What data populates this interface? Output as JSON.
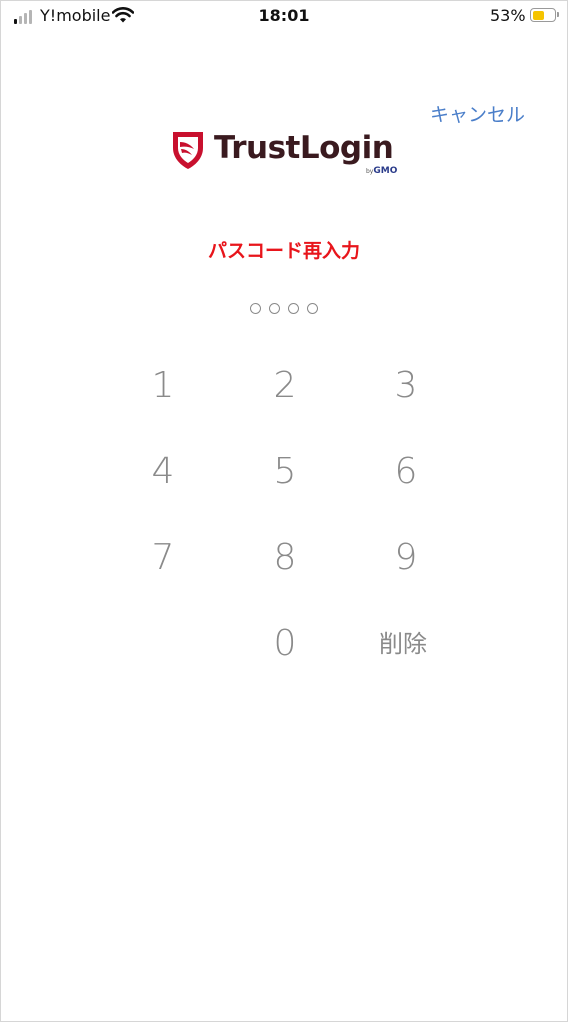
{
  "status_bar": {
    "carrier": "Y!mobile",
    "time": "18:01",
    "battery_percent": "53%",
    "battery_level": 0.53,
    "battery_color": "#f5c400"
  },
  "header": {
    "cancel_label": "キャンセル",
    "logo_text": "TrustLogin",
    "logo_by": "by",
    "logo_company": "GMO"
  },
  "prompt": {
    "title": "パスコード再入力",
    "color": "#e8151b",
    "digits_entered": 0,
    "digits_total": 4
  },
  "keypad": {
    "k1": "1",
    "k2": "2",
    "k3": "3",
    "k4": "4",
    "k5": "5",
    "k6": "6",
    "k7": "7",
    "k8": "8",
    "k9": "9",
    "k0": "0",
    "delete_label": "削除"
  },
  "colors": {
    "accent": "#4a7ec9",
    "key_text": "#8a8a8a",
    "logo_red": "#c8102e"
  }
}
